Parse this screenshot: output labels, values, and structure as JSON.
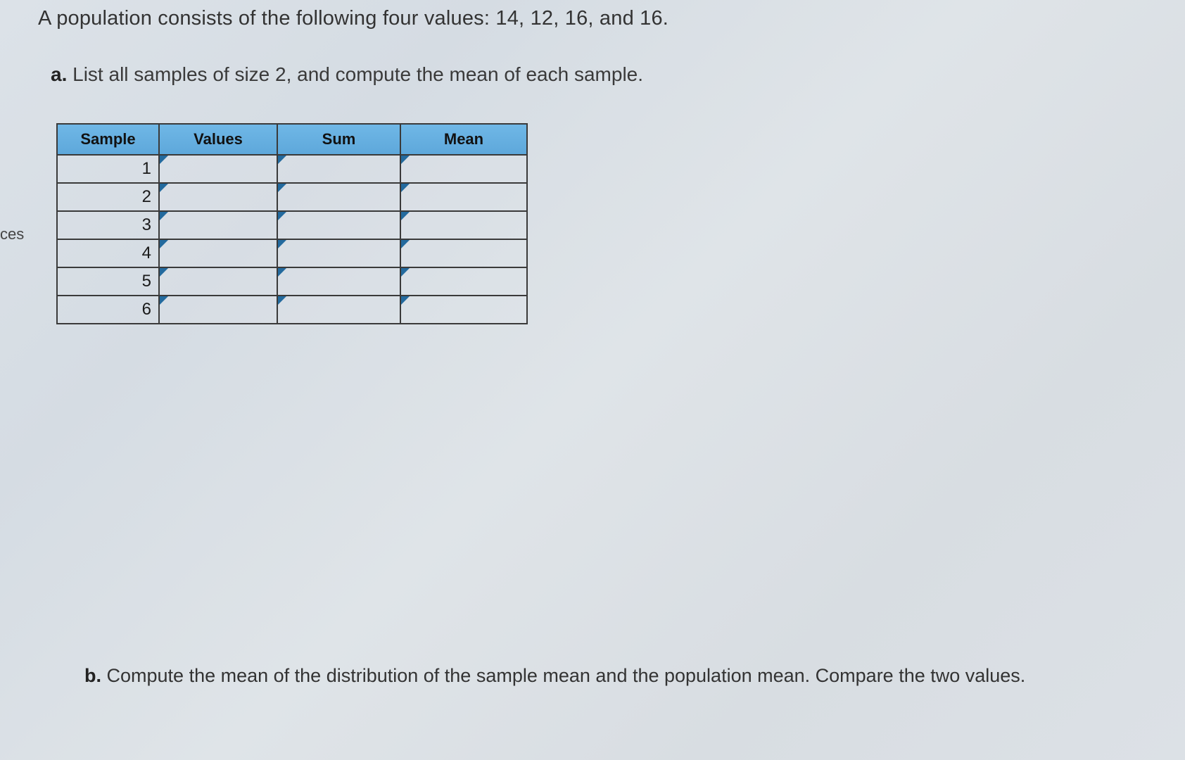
{
  "sidecut": "ces",
  "intro": "A population consists of the following four values: 14, 12, 16, and 16.",
  "part_a": {
    "label": "a.",
    "text": "List all samples of size 2, and compute the mean of each sample."
  },
  "part_b": {
    "label": "b.",
    "text": "Compute the mean of the distribution of the sample mean and the population mean. Compare the two values."
  },
  "table": {
    "headers": {
      "sample": "Sample",
      "values": "Values",
      "sum": "Sum",
      "mean": "Mean"
    },
    "rows": [
      {
        "sample": "1",
        "values": "",
        "sum": "",
        "mean": ""
      },
      {
        "sample": "2",
        "values": "",
        "sum": "",
        "mean": ""
      },
      {
        "sample": "3",
        "values": "",
        "sum": "",
        "mean": ""
      },
      {
        "sample": "4",
        "values": "",
        "sum": "",
        "mean": ""
      },
      {
        "sample": "5",
        "values": "",
        "sum": "",
        "mean": ""
      },
      {
        "sample": "6",
        "values": "",
        "sum": "",
        "mean": ""
      }
    ]
  }
}
